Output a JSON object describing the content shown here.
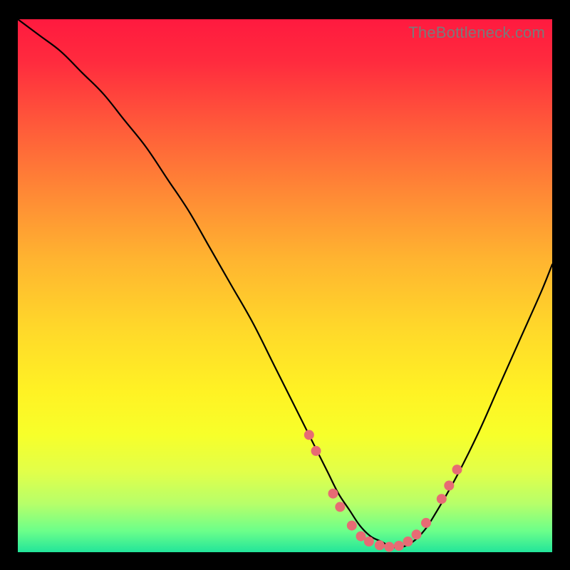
{
  "watermark": "TheBottleneck.com",
  "colors": {
    "background": "#000000",
    "curve_stroke": "#000000",
    "dot_fill": "#e76b74"
  },
  "chart_data": {
    "type": "line",
    "title": "",
    "xlabel": "",
    "ylabel": "",
    "xlim": [
      0,
      100
    ],
    "ylim": [
      0,
      100
    ],
    "grid": false,
    "legend": false,
    "series": [
      {
        "name": "curve",
        "x": [
          0,
          4,
          8,
          12,
          16,
          20,
          24,
          28,
          32,
          36,
          40,
          44,
          48,
          52,
          56,
          58,
          60,
          62,
          64,
          66,
          68,
          70,
          72,
          74,
          76,
          78,
          82,
          86,
          90,
          94,
          98,
          100
        ],
        "values": [
          100,
          97,
          94,
          90,
          86,
          81,
          76,
          70,
          64,
          57,
          50,
          43,
          35,
          27,
          19,
          15,
          11,
          8,
          5,
          3,
          2,
          1,
          1,
          2,
          4,
          7,
          14,
          22,
          31,
          40,
          49,
          54
        ]
      }
    ],
    "annotations": {
      "dots": [
        {
          "x": 54.5,
          "y": 22
        },
        {
          "x": 55.8,
          "y": 19
        },
        {
          "x": 59.0,
          "y": 11
        },
        {
          "x": 60.3,
          "y": 8.5
        },
        {
          "x": 62.5,
          "y": 5
        },
        {
          "x": 64.2,
          "y": 3
        },
        {
          "x": 65.7,
          "y": 2
        },
        {
          "x": 67.7,
          "y": 1.3
        },
        {
          "x": 69.5,
          "y": 1
        },
        {
          "x": 71.3,
          "y": 1.2
        },
        {
          "x": 73.0,
          "y": 2
        },
        {
          "x": 74.6,
          "y": 3.3
        },
        {
          "x": 76.4,
          "y": 5.5
        },
        {
          "x": 79.3,
          "y": 10
        },
        {
          "x": 80.7,
          "y": 12.5
        },
        {
          "x": 82.2,
          "y": 15.5
        }
      ]
    }
  }
}
